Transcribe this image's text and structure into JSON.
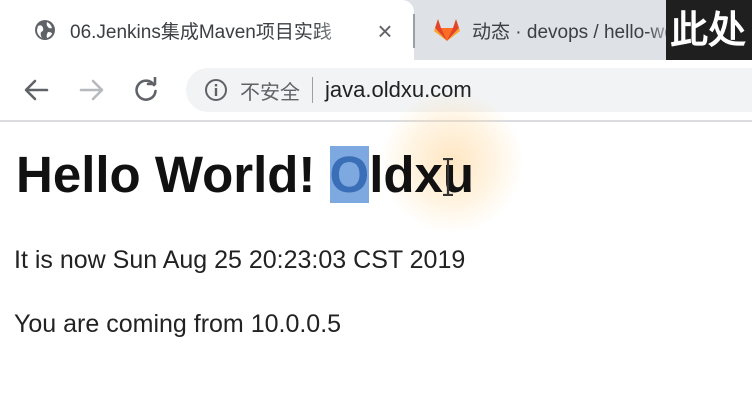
{
  "browser": {
    "tabs": [
      {
        "title": "06.Jenkins集成Maven项目实践",
        "icon": "globe-icon",
        "active": true
      },
      {
        "title": "动态 · devops / hello-world",
        "icon": "gitlab-icon",
        "active": false
      }
    ],
    "watermark": "此处",
    "address_bar": {
      "security_label": "不安全",
      "url": "java.oldxu.com"
    }
  },
  "page": {
    "heading_prefix": "Hello World! ",
    "heading_selected": "O",
    "heading_suffix": "ldxu",
    "time_line": "It is now Sun Aug 25 20:23:03 CST 2019",
    "ip_line": "You are coming from 10.0.0.5"
  },
  "colors": {
    "tab_strip": "#dee1e6",
    "selection": "#7ea9e0",
    "gitlab_orange": "#e24329",
    "cursor_glow": "#ffd28a"
  }
}
